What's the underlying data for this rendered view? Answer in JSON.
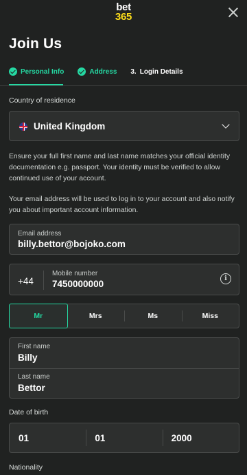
{
  "brand": {
    "line1": "bet",
    "line2": "365"
  },
  "page_title": "Join Us",
  "steps": [
    {
      "label": "Personal Info",
      "state": "complete",
      "active": true
    },
    {
      "label": "Address",
      "state": "complete",
      "active": false
    },
    {
      "number": "3.",
      "label": "Login Details",
      "state": "pending",
      "active": false
    }
  ],
  "country": {
    "label": "Country of residence",
    "value": "United Kingdom",
    "flag_icon": "uk-flag-icon"
  },
  "notice_identity": "Ensure your full first name and last name matches your official identity documentation e.g. passport. Your identity must be verified to allow continued use of your account.",
  "notice_email": "Your email address will be used to log in to your account and also notify you about important account information.",
  "email": {
    "label": "Email address",
    "value": "billy.bettor@bojoko.com"
  },
  "mobile": {
    "prefix": "+44",
    "label": "Mobile number",
    "value": "7450000000",
    "info_icon": "i"
  },
  "titles": {
    "options": [
      "Mr",
      "Mrs",
      "Ms",
      "Miss"
    ],
    "selected": "Mr"
  },
  "first_name": {
    "label": "First name",
    "value": "Billy"
  },
  "last_name": {
    "label": "Last name",
    "value": "Bettor"
  },
  "dob": {
    "label": "Date of birth",
    "day": "01",
    "month": "01",
    "year": "2000"
  },
  "nationality": {
    "label": "Nationality"
  },
  "colors": {
    "accent": "#25d8a2",
    "brand_yellow": "#ffdf1b",
    "background": "#202221",
    "field": "#2d2f2e",
    "border": "#4a4c4b"
  }
}
